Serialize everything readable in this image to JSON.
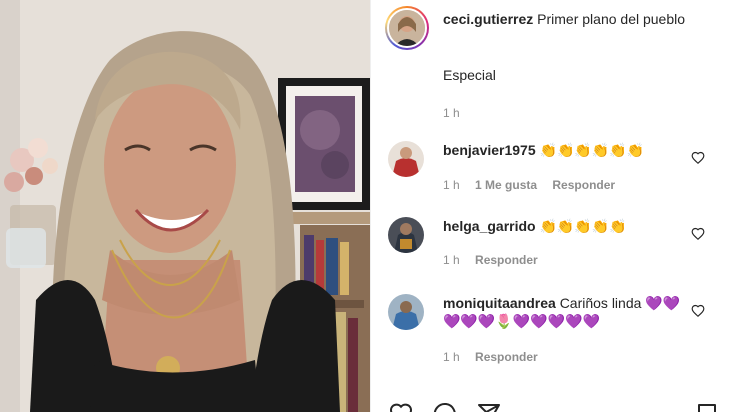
{
  "caption": {
    "username": "ceci.gutierrez",
    "text": "Primer plano del pueblo",
    "extra": "Especial",
    "time": "1 h"
  },
  "comments": [
    {
      "username": "benjavier1975",
      "text": "👏👏👏👏👏👏",
      "time": "1 h",
      "likes": "1 Me gusta",
      "reply": "Responder"
    },
    {
      "username": "helga_garrido",
      "text": "👏👏👏👏👏",
      "time": "1 h",
      "reply": "Responder"
    },
    {
      "username": "moniquitaandrea",
      "text": "Cariños linda 💜💜💜💜💜🌷💜💜💜💜💜",
      "time": "1 h",
      "reply": "Responder"
    }
  ],
  "icons": [
    "heart-icon",
    "comment-icon",
    "share-icon",
    "bookmark-icon"
  ],
  "colors": {
    "text": "#262626",
    "muted": "#8e8e8e",
    "border": "#efefef"
  }
}
